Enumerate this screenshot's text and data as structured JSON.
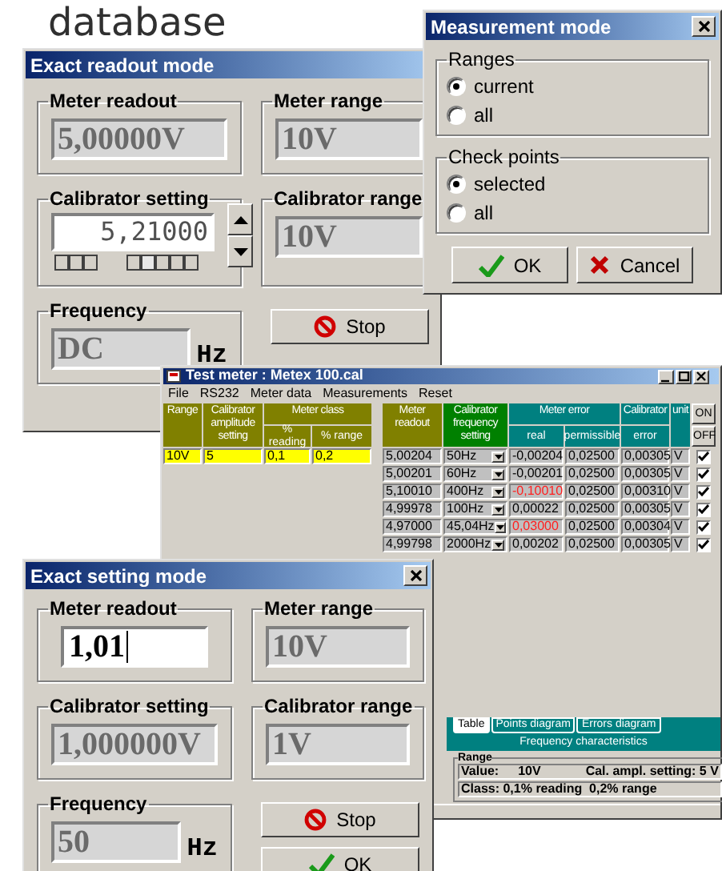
{
  "background_text": "database",
  "exact_readout": {
    "title": "Exact readout mode",
    "fields": [
      {
        "label": "Meter readout",
        "value": "5,00000V",
        "kind": "readonly"
      },
      {
        "label": "Meter range",
        "value": "10V",
        "kind": "readonly"
      },
      {
        "label": "Calibrator setting",
        "value": "5,21000",
        "kind": "spin"
      },
      {
        "label": "Calibrator range",
        "value": "10V",
        "kind": "readonly"
      },
      {
        "label": "Frequency",
        "value": "DC",
        "unit": "Hz",
        "kind": "frequency"
      }
    ],
    "buttons": [
      {
        "label": "Stop",
        "kind": "stop"
      }
    ]
  },
  "measurement_mode": {
    "title": "Measurement mode",
    "groups": [
      {
        "label": "Ranges",
        "options": [
          {
            "label": "current",
            "selected": true
          },
          {
            "label": "all",
            "selected": false
          }
        ]
      },
      {
        "label": "Check points",
        "options": [
          {
            "label": "selected",
            "selected": true
          },
          {
            "label": "all",
            "selected": false
          }
        ]
      }
    ],
    "buttons": [
      {
        "label": "OK",
        "kind": "ok"
      },
      {
        "label": "Cancel",
        "kind": "cancel"
      }
    ]
  },
  "test_meter": {
    "title": "Test meter : Metex 100.cal",
    "menu": [
      "File",
      "RS232",
      "Meter data",
      "Measurements",
      "Reset"
    ],
    "left_table": {
      "headers": [
        {
          "label": "Range",
          "color": "#808000"
        },
        {
          "label": "Calibrator amplitude setting",
          "color": "#808000"
        },
        {
          "label": "Meter class",
          "color": "#808000",
          "sub": [
            "% reading",
            "% range"
          ]
        }
      ],
      "rows": [
        [
          "10V",
          "5",
          "0,1",
          "0,2"
        ]
      ]
    },
    "right_table": {
      "headers": [
        {
          "label": "Meter readout",
          "color": "#808000"
        },
        {
          "label": "Calibrator frequency setting",
          "color": "#008000"
        },
        {
          "label": "Meter error",
          "color": "#008080",
          "sub": [
            "real",
            "permissible"
          ]
        },
        {
          "label": "Calibrator",
          "color": "#008080",
          "sub": [
            "error"
          ]
        },
        {
          "label": "unit",
          "color": "#008080"
        }
      ],
      "switches": [
        "ON",
        "OFF"
      ],
      "rows": [
        {
          "readout": "5,00204",
          "frequency": "50Hz",
          "real": "-0,00204",
          "out_of_tolerance": false,
          "permissible": "0,02500",
          "cal_error": "0,00305",
          "unit": "V",
          "checked": true
        },
        {
          "readout": "5,00201",
          "frequency": "60Hz",
          "real": "-0,00201",
          "out_of_tolerance": false,
          "permissible": "0,02500",
          "cal_error": "0,00305",
          "unit": "V",
          "checked": true
        },
        {
          "readout": "5,10010",
          "frequency": "400Hz",
          "real": "-0,10010",
          "out_of_tolerance": true,
          "permissible": "0,02500",
          "cal_error": "0,00310",
          "unit": "V",
          "checked": true
        },
        {
          "readout": "4,99978",
          "frequency": "100Hz",
          "real": "0,00022",
          "out_of_tolerance": false,
          "permissible": "0,02500",
          "cal_error": "0,00305",
          "unit": "V",
          "checked": true
        },
        {
          "readout": "4,97000",
          "frequency": "45,04Hz",
          "real": "0,03000",
          "out_of_tolerance": true,
          "permissible": "0,02500",
          "cal_error": "0,00304",
          "unit": "V",
          "checked": true
        },
        {
          "readout": "4,99798",
          "frequency": "2000Hz",
          "real": "0,00202",
          "out_of_tolerance": false,
          "permissible": "0,02500",
          "cal_error": "0,00305",
          "unit": "V",
          "checked": true
        }
      ]
    },
    "tabs": [
      {
        "label": "Table",
        "selected": true
      },
      {
        "label": "Points diagram",
        "selected": false
      },
      {
        "label": "Errors diagram",
        "selected": false
      }
    ],
    "band_text": "Frequency characteristics",
    "range_panel": {
      "label": "Range",
      "value_label": "Value:",
      "value": "10V",
      "cal_setting": "Cal. ampl. setting: 5 V",
      "class_text": "Class: 0,1% reading  0,2% range"
    }
  },
  "exact_setting": {
    "title": "Exact setting mode",
    "fields": [
      {
        "label": "Meter readout",
        "value": "1,01",
        "kind": "input"
      },
      {
        "label": "Meter range",
        "value": "10V",
        "kind": "readonly"
      },
      {
        "label": "Calibrator setting",
        "value": "1,000000V",
        "kind": "readonly"
      },
      {
        "label": "Calibrator range",
        "value": "1V",
        "kind": "readonly"
      },
      {
        "label": "Frequency",
        "value": "50",
        "unit": "Hz",
        "kind": "frequency"
      }
    ],
    "buttons": [
      {
        "label": "Stop",
        "kind": "stop"
      },
      {
        "label": "OK",
        "kind": "ok"
      }
    ]
  }
}
